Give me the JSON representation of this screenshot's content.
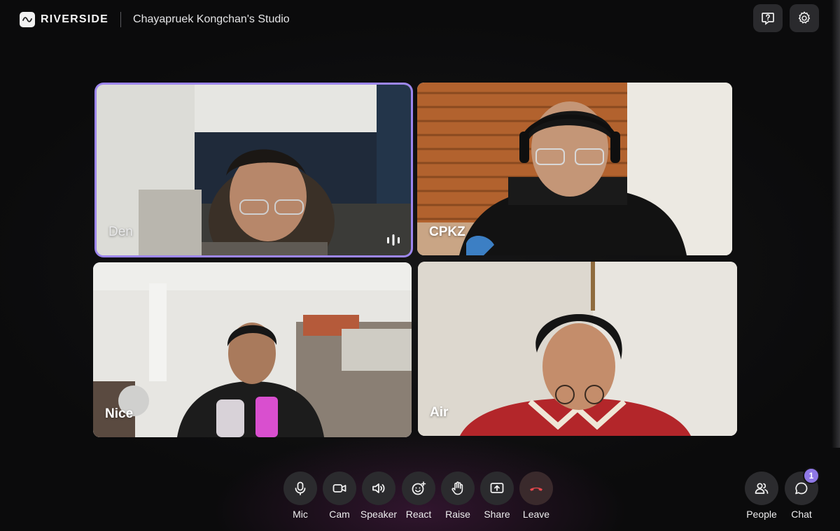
{
  "app": {
    "brand": "RIVERSIDE",
    "studio_name": "Chayapruek Kongchan's Studio"
  },
  "participants": [
    {
      "name": "Den",
      "speaking": true
    },
    {
      "name": "CPKZ",
      "speaking": false
    },
    {
      "name": "Nice",
      "speaking": false
    },
    {
      "name": "Air",
      "speaking": false
    }
  ],
  "controls": {
    "mic": "Mic",
    "cam": "Cam",
    "speaker": "Speaker",
    "react": "React",
    "raise": "Raise",
    "share": "Share",
    "leave": "Leave",
    "people": "People",
    "chat": "Chat",
    "chat_unread": "1"
  },
  "icons": {
    "top_right": [
      "help-icon",
      "settings-icon"
    ],
    "leave_color": "#e5484d",
    "active_speaker_color": "#9d86f0"
  }
}
